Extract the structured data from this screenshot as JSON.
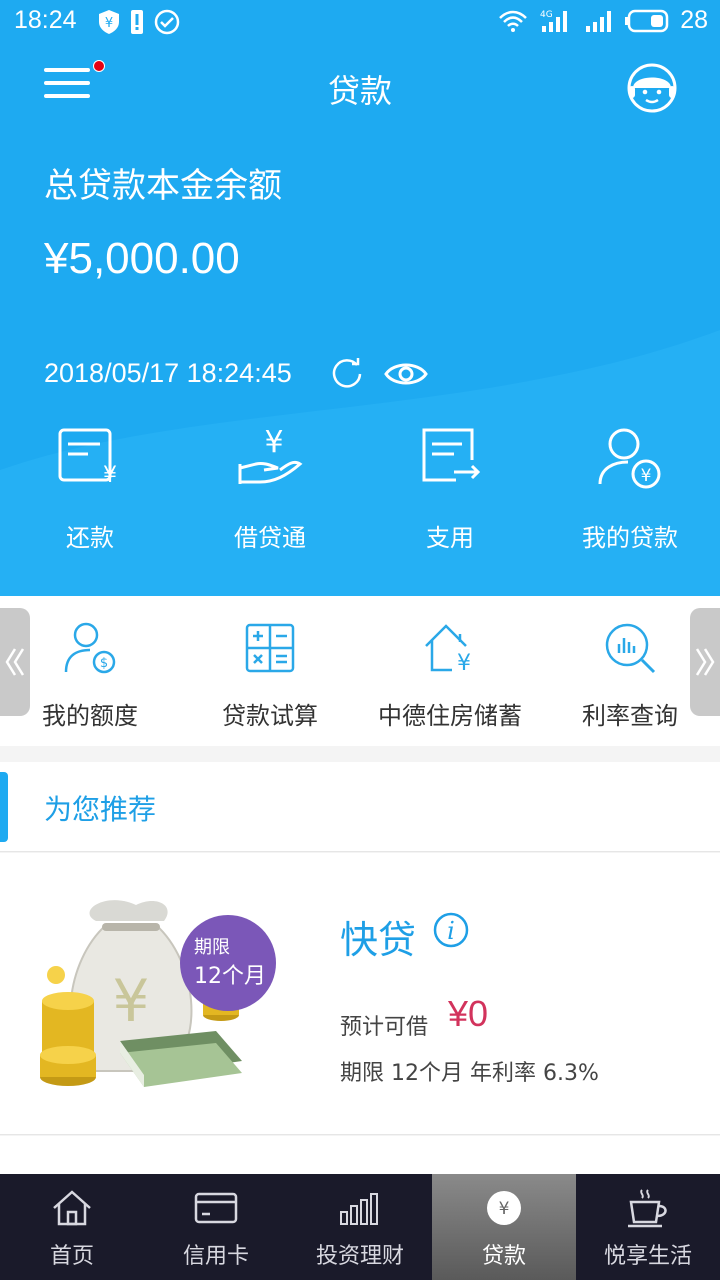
{
  "status_bar": {
    "time": "18:24",
    "battery": "28",
    "network": "4G"
  },
  "header": {
    "title": "贷款"
  },
  "balance": {
    "label": "总贷款本金余额",
    "amount": "¥5,000.00",
    "timestamp": "2018/05/17 18:24:45"
  },
  "quick_actions": [
    {
      "label": "还款",
      "icon": "repay-icon"
    },
    {
      "label": "借贷通",
      "icon": "loan-hand-icon"
    },
    {
      "label": "支用",
      "icon": "withdraw-icon"
    },
    {
      "label": "我的贷款",
      "icon": "my-loan-icon"
    }
  ],
  "services": [
    {
      "label": "我的额度",
      "icon": "quota-icon"
    },
    {
      "label": "贷款试算",
      "icon": "calculator-icon"
    },
    {
      "label": "中德住房储蓄",
      "icon": "house-savings-icon"
    },
    {
      "label": "利率查询",
      "icon": "rate-search-icon"
    }
  ],
  "recommend": {
    "section_title": "为您推荐",
    "badge_line1": "期限",
    "badge_line2": "12个月",
    "product": {
      "name": "快贷",
      "borrow_label": "预计可借",
      "borrow_amount": "¥0",
      "terms": "期限 12个月  年利率 6.3%"
    }
  },
  "bottom_nav": [
    {
      "label": "首页",
      "icon": "home-icon"
    },
    {
      "label": "信用卡",
      "icon": "credit-card-icon"
    },
    {
      "label": "投资理财",
      "icon": "invest-chart-icon"
    },
    {
      "label": "贷款",
      "icon": "loan-yen-icon",
      "active": true
    },
    {
      "label": "悦享生活",
      "icon": "coffee-cup-icon"
    }
  ],
  "colors": {
    "primary": "#1eaaf1",
    "accent_red": "#d2335c",
    "nav_bg": "#1a1a2a"
  }
}
